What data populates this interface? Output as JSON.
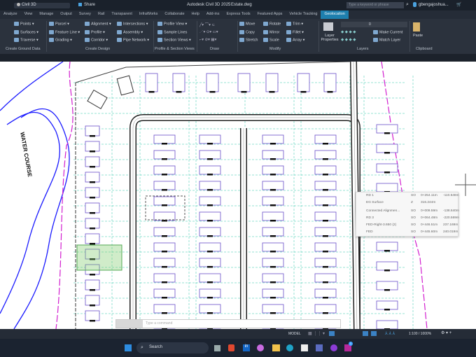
{
  "title_bar": {
    "workspace": "Civil 3D",
    "share": "Share",
    "app_title": "Autodesk Civil 3D 2025",
    "file": "Estate.dwg",
    "search_placeholder": "Type a keyword or phrase",
    "user": "gbengajoshua..."
  },
  "tabs": [
    "Analyze",
    "View",
    "Manage",
    "Output",
    "Survey",
    "Rail",
    "Transparent",
    "InfraWorks",
    "Collaborate",
    "Help",
    "Add-ins",
    "Express Tools",
    "Featured Apps",
    "Vehicle Tracking",
    "Geolocation"
  ],
  "active_tab": "Geolocation",
  "ribbon": {
    "create_ground": {
      "items": [
        "Points",
        "Surfaces",
        "Traverse"
      ],
      "label": "Create Ground Data"
    },
    "create_design": {
      "items": [
        "Parcel",
        "Feature Line",
        "Grading",
        "Alignment",
        "Profile",
        "Corridor",
        "Intersections",
        "Assembly",
        "Pipe Network"
      ],
      "label": "Create Design"
    },
    "profile_section": {
      "items": [
        "Profile View",
        "Sample Lines",
        "Section Views"
      ],
      "label": "Profile & Section Views"
    },
    "draw": {
      "label": "Draw"
    },
    "modify": {
      "items": [
        "Move",
        "Copy",
        "Stretch",
        "Rotate",
        "Mirror",
        "Scale",
        "Trim",
        "Fillet",
        "Array"
      ],
      "label": "Modify"
    },
    "layers": {
      "layer_properties": "Layer Properties",
      "current_layer": "0",
      "make_current": "Make Current",
      "match_layer": "Match Layer",
      "label": "Layers"
    },
    "clipboard": {
      "paste": "Paste",
      "label": "Clipboard"
    }
  },
  "drawing": {
    "annotation": "WATER COURSE"
  },
  "tooltip": {
    "rows": [
      {
        "name": "RD 1",
        "code": "SO",
        "station": "0+254.11m",
        "offset": "-110.548m"
      },
      {
        "name": "EG Surface",
        "code": "Z",
        "station": "316.244m",
        "offset": ""
      },
      {
        "name": "Connected Alignmen...",
        "code": "SO",
        "station": "0+009.59m",
        "offset": "-138.640m"
      },
      {
        "name": "RD 3",
        "code": "SO",
        "station": "0+064.48m",
        "offset": "-220.569m"
      },
      {
        "name": "FED-Right-3.650 (2)",
        "code": "SO",
        "station": "0+446.51m",
        "offset": "237.169m"
      },
      {
        "name": "FED",
        "code": "SO",
        "station": "0+445.60m",
        "offset": "240.019m"
      }
    ]
  },
  "command": {
    "placeholder": "Type a command"
  },
  "status": {
    "model": "MODEL",
    "scale": "1:100 / 1000%"
  },
  "taskbar": {
    "search": "Search",
    "badge": "1"
  },
  "colors": {
    "accent": "#1e7fae",
    "road": "#222222",
    "parcel": "#6a4fc9",
    "boundary": "#d21ecf",
    "grid": "#2ec7a8"
  }
}
